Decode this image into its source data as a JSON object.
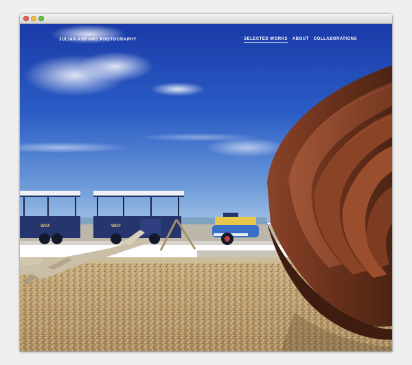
{
  "brand": "JULIAN ABRAMS PHOTOGRAPHY",
  "nav": {
    "selected_works": "SELECTED WORKS",
    "about": "ABOUT",
    "collaborations": "COLLABORATIONS",
    "active": "SELECTED WORKS"
  },
  "train": {
    "carriage_label": "WGF"
  },
  "colors": {
    "sky_top": "#1c3fae",
    "sky_horizon": "#8fb7de",
    "sculpture_rust": "#6b321c",
    "train_blue": "#27356e",
    "train_roof": "#eef1f6",
    "shingle": "#b79a6c"
  }
}
